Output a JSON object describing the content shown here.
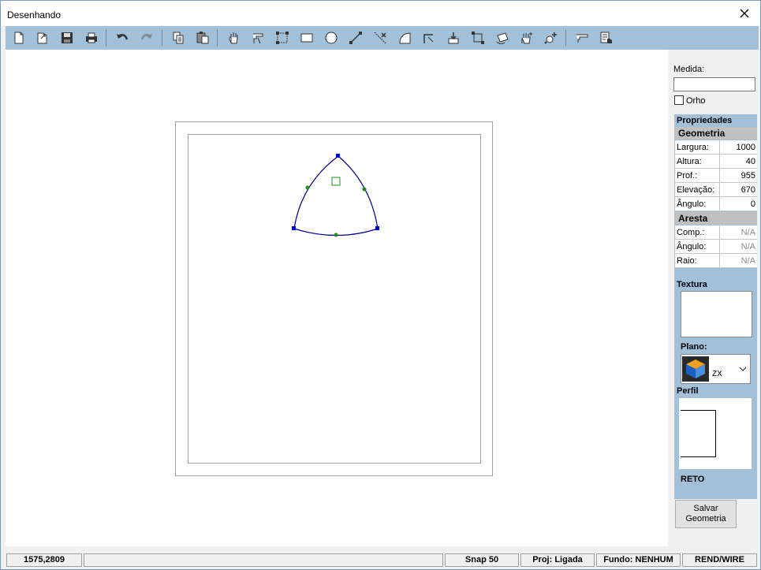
{
  "window": {
    "title": "Desenhando"
  },
  "toolbar": {
    "icons": [
      "new-file-icon",
      "open-file-icon",
      "save-icon",
      "print-icon",
      "undo-icon",
      "redo-icon",
      "copy-icon",
      "paste-icon",
      "pan-hand-icon",
      "shape-tool-icon",
      "dimension-icon",
      "rectangle-icon",
      "circle-icon",
      "line-icon",
      "trim-icon",
      "arc-icon",
      "corner-icon",
      "insert-icon",
      "scale-icon",
      "rotate-icon",
      "move-icon",
      "zoom-icon",
      "layers-icon",
      "properties-icon"
    ]
  },
  "panel": {
    "medida_label": "Medida:",
    "medida_value": "",
    "orho_label": "Orho",
    "orho_checked": false,
    "propriedades_label": "Propriedades",
    "geometria_label": "Geometria",
    "geometria": [
      {
        "label": "Largura:",
        "value": "1000"
      },
      {
        "label": "Altura:",
        "value": "40"
      },
      {
        "label": "Prof.:",
        "value": "955"
      },
      {
        "label": "Elevação:",
        "value": "670"
      },
      {
        "label": "Ângulo:",
        "value": "0"
      }
    ],
    "aresta_label": "Aresta",
    "aresta": [
      {
        "label": "Comp.:",
        "value": "N/A"
      },
      {
        "label": "Ângulo:",
        "value": "N/A"
      },
      {
        "label": "Raio:",
        "value": "N/A"
      }
    ],
    "textura_label": "Textura",
    "plano_label": "Plano:",
    "plano_value": "ZX",
    "perfil_label": "Perfil",
    "perfil_value": "RETO",
    "save_label_1": "Salvar",
    "save_label_2": "Geometria"
  },
  "status": {
    "coords": "1575,2809",
    "snap": "Snap 50",
    "proj": "Proj: Ligada",
    "fundo": "Fundo: NENHUM",
    "rend": "REND/WIRE"
  },
  "colors": {
    "toolbar_bg": "#a2c0d8",
    "shape_stroke": "#00008b",
    "vertex_handle": "#0000cc",
    "midpoint_handle": "#228b22"
  }
}
